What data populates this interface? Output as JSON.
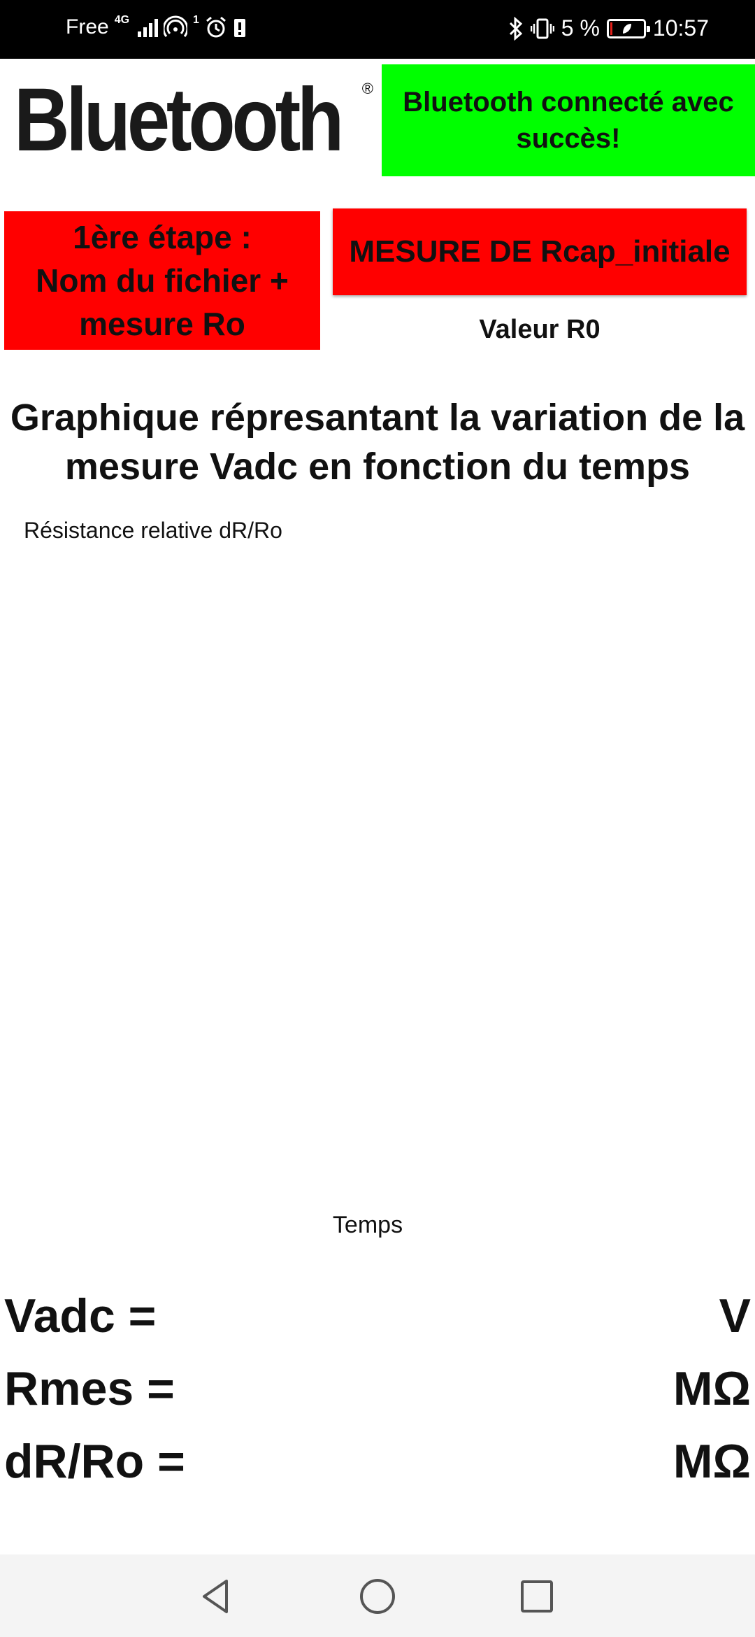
{
  "status_bar": {
    "carrier": "Free",
    "network": "4G",
    "hotspot_count": "1",
    "battery_percent": "5 %",
    "battery_level": 0.05,
    "time": "10:57",
    "icons": [
      "signal-icon",
      "hotspot-icon",
      "alarm-icon",
      "alert-icon",
      "bluetooth-icon",
      "vibrate-icon",
      "battery-icon"
    ]
  },
  "header": {
    "logo_text": "Bluetooth",
    "logo_reg": "®",
    "connection_status": "Bluetooth connecté avec succès!",
    "status_color": "#00ff00"
  },
  "actions": {
    "step_button": "1ère étape :\nNom du fichier + mesure Ro",
    "rcap_button": "MESURE DE Rcap_initiale",
    "r0_label": "Valeur R0",
    "button_color": "#ff0000"
  },
  "chart": {
    "title": "Graphique répresantant la variation de la mesure Vadc en fonction du temps"
  },
  "chart_data": {
    "type": "line",
    "title": "Graphique répresantant la variation de la mesure Vadc en fonction du temps",
    "xlabel": "Temps",
    "ylabel": "Résistance relative dR/Ro",
    "series": [],
    "grid": false
  },
  "readouts": [
    {
      "label": "Vadc =",
      "value": "",
      "unit": "V"
    },
    {
      "label": "Rmes =",
      "value": "",
      "unit": "MΩ"
    },
    {
      "label": "dR/Ro =",
      "value": "",
      "unit": "MΩ"
    }
  ],
  "nav": {
    "icons": [
      "back-icon",
      "home-icon",
      "recents-icon"
    ]
  }
}
